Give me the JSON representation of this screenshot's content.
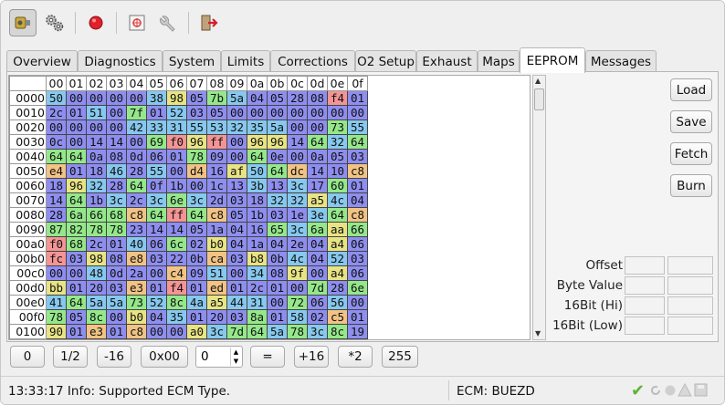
{
  "toolbar": {
    "buttons": [
      {
        "icon": "connect-icon",
        "pressed": true
      },
      {
        "icon": "settings-gears-icon",
        "pressed": false
      },
      {
        "icon": "record-icon",
        "pressed": false
      },
      {
        "icon": "ecu-chip-icon",
        "pressed": false
      },
      {
        "icon": "wrench-tools-icon",
        "pressed": false
      },
      {
        "icon": "exit-icon",
        "pressed": false
      }
    ]
  },
  "tabs": [
    {
      "label": "Overview"
    },
    {
      "label": "Diagnostics"
    },
    {
      "label": "System"
    },
    {
      "label": "Limits"
    },
    {
      "label": "Corrections"
    },
    {
      "label": "O2 Setup"
    },
    {
      "label": "Exhaust"
    },
    {
      "label": "Maps"
    },
    {
      "label": "EEPROM",
      "active": true
    },
    {
      "label": "Messages"
    }
  ],
  "grid": {
    "columns": [
      "00",
      "01",
      "02",
      "03",
      "04",
      "05",
      "06",
      "07",
      "08",
      "09",
      "0a",
      "0b",
      "0c",
      "0d",
      "0e",
      "0f"
    ],
    "rows": [
      {
        "addr": "0000",
        "bytes": [
          "50",
          "00",
          "00",
          "00",
          "00",
          "38",
          "98",
          "05",
          "7b",
          "5a",
          "04",
          "05",
          "28",
          "08",
          "f4",
          "01"
        ]
      },
      {
        "addr": "0010",
        "bytes": [
          "2c",
          "01",
          "51",
          "00",
          "7f",
          "01",
          "52",
          "03",
          "05",
          "00",
          "00",
          "00",
          "00",
          "00",
          "00",
          "00"
        ]
      },
      {
        "addr": "0020",
        "bytes": [
          "00",
          "00",
          "00",
          "00",
          "42",
          "33",
          "31",
          "55",
          "53",
          "32",
          "35",
          "5a",
          "00",
          "00",
          "73",
          "55"
        ]
      },
      {
        "addr": "0030",
        "bytes": [
          "0c",
          "00",
          "14",
          "14",
          "00",
          "69",
          "f0",
          "96",
          "ff",
          "00",
          "96",
          "96",
          "14",
          "64",
          "32",
          "64"
        ]
      },
      {
        "addr": "0040",
        "bytes": [
          "64",
          "64",
          "0a",
          "08",
          "0d",
          "06",
          "01",
          "78",
          "09",
          "00",
          "64",
          "0e",
          "00",
          "0a",
          "05",
          "03"
        ]
      },
      {
        "addr": "0050",
        "bytes": [
          "e4",
          "01",
          "18",
          "46",
          "28",
          "55",
          "00",
          "d4",
          "16",
          "af",
          "50",
          "64",
          "dc",
          "14",
          "10",
          "c8"
        ]
      },
      {
        "addr": "0060",
        "bytes": [
          "18",
          "96",
          "32",
          "28",
          "64",
          "0f",
          "1b",
          "00",
          "1c",
          "13",
          "3b",
          "13",
          "3c",
          "17",
          "60",
          "01"
        ]
      },
      {
        "addr": "0070",
        "bytes": [
          "14",
          "64",
          "1b",
          "3c",
          "2c",
          "3c",
          "6e",
          "3c",
          "2d",
          "03",
          "18",
          "32",
          "32",
          "a5",
          "4c",
          "04"
        ]
      },
      {
        "addr": "0080",
        "bytes": [
          "28",
          "6a",
          "66",
          "68",
          "c8",
          "64",
          "ff",
          "64",
          "c8",
          "05",
          "1b",
          "03",
          "1e",
          "3e",
          "64",
          "c8"
        ]
      },
      {
        "addr": "0090",
        "bytes": [
          "87",
          "82",
          "78",
          "78",
          "23",
          "14",
          "14",
          "05",
          "1a",
          "04",
          "16",
          "65",
          "3c",
          "6a",
          "aa",
          "66"
        ]
      },
      {
        "addr": "00a0",
        "bytes": [
          "f0",
          "68",
          "2c",
          "01",
          "40",
          "06",
          "6c",
          "02",
          "b0",
          "04",
          "1a",
          "04",
          "2e",
          "04",
          "a4",
          "06"
        ]
      },
      {
        "addr": "00b0",
        "bytes": [
          "fc",
          "03",
          "98",
          "08",
          "e8",
          "03",
          "22",
          "0b",
          "ca",
          "03",
          "b8",
          "0b",
          "4c",
          "04",
          "52",
          "03"
        ]
      },
      {
        "addr": "00c0",
        "bytes": [
          "00",
          "00",
          "48",
          "0d",
          "2a",
          "00",
          "c4",
          "09",
          "51",
          "00",
          "34",
          "08",
          "9f",
          "00",
          "a4",
          "06"
        ]
      },
      {
        "addr": "00d0",
        "bytes": [
          "bb",
          "01",
          "20",
          "03",
          "e3",
          "01",
          "f4",
          "01",
          "ed",
          "01",
          "2c",
          "01",
          "00",
          "7d",
          "28",
          "6e"
        ]
      },
      {
        "addr": "00e0",
        "bytes": [
          "41",
          "64",
          "5a",
          "5a",
          "73",
          "52",
          "8c",
          "4a",
          "a5",
          "44",
          "31",
          "00",
          "72",
          "06",
          "56",
          "00"
        ]
      },
      {
        "addr": "00f0",
        "bytes": [
          "78",
          "05",
          "8c",
          "00",
          "b0",
          "04",
          "35",
          "01",
          "20",
          "03",
          "8a",
          "01",
          "58",
          "02",
          "c5",
          "01"
        ]
      },
      {
        "addr": "0100",
        "bytes": [
          "90",
          "01",
          "e3",
          "01",
          "c8",
          "00",
          "00",
          "a0",
          "3c",
          "7d",
          "64",
          "5a",
          "78",
          "3c",
          "8c",
          "19"
        ]
      }
    ]
  },
  "side_buttons": {
    "load": "Load",
    "save": "Save",
    "fetch": "Fetch",
    "burn": "Burn"
  },
  "fields": {
    "offset": "Offset",
    "byte_value": "Byte Value",
    "bit16_hi": "16Bit (Hi)",
    "bit16_low": "16Bit (Low)"
  },
  "bottom_bar": {
    "btn_0": "0",
    "btn_half": "1/2",
    "btn_minus16": "-16",
    "btn_0x00": "0x00",
    "spin_value": "0",
    "btn_eq": "=",
    "btn_plus16": "+16",
    "btn_times2": "*2",
    "btn_255": "255"
  },
  "status": {
    "message": "13:33:17 Info: Supported ECM Type.",
    "ecm": "ECM: BUEZD"
  },
  "colors": {
    "low": "#8e8ef0",
    "mid_low": "#86c8ee",
    "mid": "#94e88a",
    "mid_high": "#e8e484",
    "high": "#f1c384",
    "max": "#f49494"
  }
}
